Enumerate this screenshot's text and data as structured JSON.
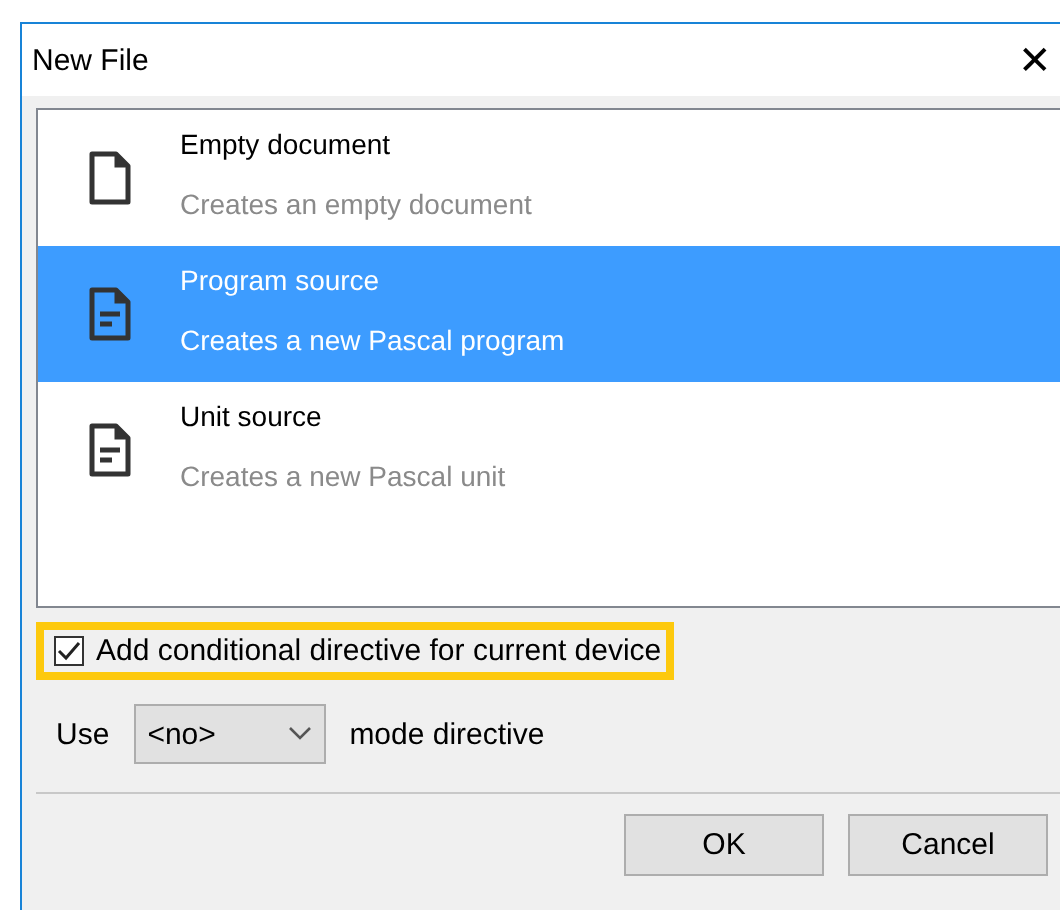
{
  "window": {
    "title": "New File",
    "close": "✕"
  },
  "items": [
    {
      "kind": "blank",
      "title": "Empty document",
      "description": "Creates an empty document",
      "selected": false
    },
    {
      "kind": "text",
      "title": "Program source",
      "description": "Creates a new Pascal program",
      "selected": true
    },
    {
      "kind": "text",
      "title": "Unit source",
      "description": "Creates a new Pascal unit",
      "selected": false
    }
  ],
  "checkbox": {
    "label": "Add conditional directive for current device",
    "checked": true,
    "highlighted": true
  },
  "mode": {
    "prefix": "Use",
    "value": "<no>",
    "suffix": "mode directive"
  },
  "buttons": [
    "OK",
    "Cancel"
  ]
}
